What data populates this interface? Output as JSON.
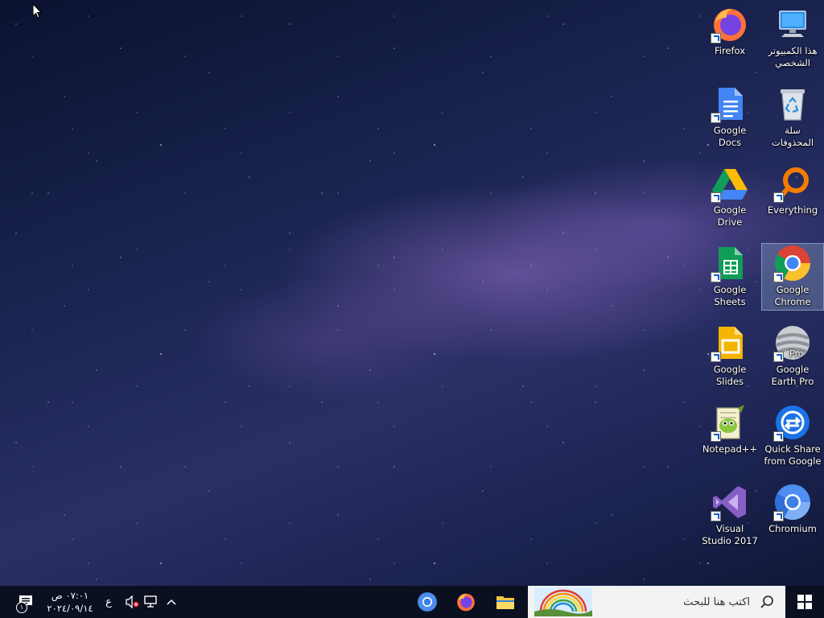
{
  "desktop": {
    "icons": [
      {
        "label": "هذا الكمبيوتر الشخصي",
        "icon": "computer-icon"
      },
      {
        "label": "Firefox",
        "icon": "firefox-icon"
      },
      {
        "label": "سلة المحذوفات",
        "icon": "recycle-bin-icon"
      },
      {
        "label": "Google Docs",
        "icon": "google-docs-icon"
      },
      {
        "label": "Everything",
        "icon": "everything-search-icon"
      },
      {
        "label": "Google Drive",
        "icon": "google-drive-icon"
      },
      {
        "label": "Google Chrome",
        "icon": "chrome-icon"
      },
      {
        "label": "Google Sheets",
        "icon": "google-sheets-icon"
      },
      {
        "label": "Google Earth Pro",
        "icon": "google-earth-pro-icon"
      },
      {
        "label": "Google Slides",
        "icon": "google-slides-icon"
      },
      {
        "label": "Quick Share from Google",
        "icon": "quick-share-icon"
      },
      {
        "label": "Notepad++",
        "icon": "notepad-plus-plus-icon"
      },
      {
        "label": "Chromium",
        "icon": "chromium-icon"
      },
      {
        "label": "Visual Studio 2017",
        "icon": "visual-studio-icon"
      }
    ],
    "earth_badge": "Pro"
  },
  "taskbar": {
    "search_placeholder": "اكتب هنا للبحث",
    "clock_time": "٠٧:٠١ ص",
    "clock_date": "٢٠٢٤/٠٩/١٤",
    "language": "ع",
    "notification_count": "١"
  },
  "colors": {
    "taskbar_bg": "#0b1020",
    "search_bg": "#f3f3f3",
    "windows_blue": "#1e8ee6"
  }
}
